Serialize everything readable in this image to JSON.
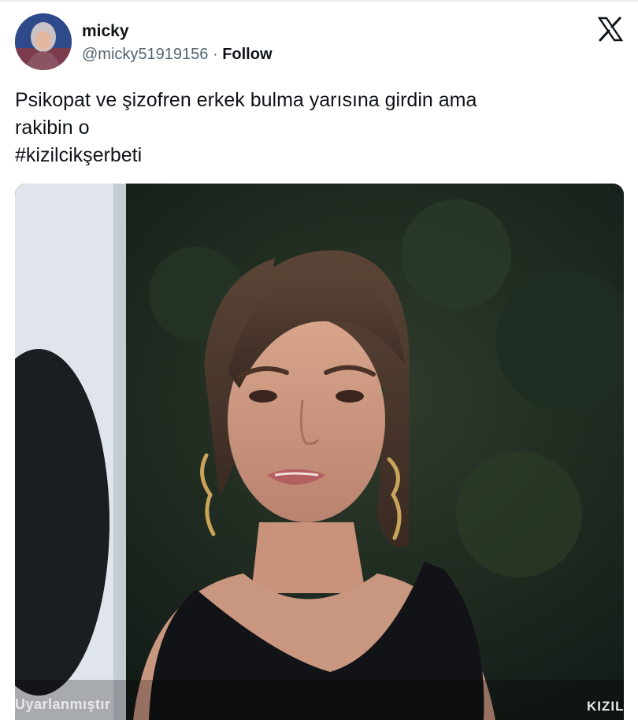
{
  "author": {
    "display_name": "micky",
    "handle": "@micky51919156",
    "separator": "·",
    "follow_label": "Follow",
    "avatar_icon": "user-avatar"
  },
  "platform": {
    "logo_icon": "x-logo-icon"
  },
  "tweet": {
    "line1": "Psikopat ve şizofren erkek bulma yarısına girdin ama",
    "line2": "rakibin o",
    "hashtag": "#kizilcikşerbeti"
  },
  "media": {
    "caption_left": "Uyarlanmıştır",
    "caption_right": "KIZIL"
  },
  "colors": {
    "text": "#0f1419",
    "secondary": "#536471",
    "background": "#ffffff"
  }
}
